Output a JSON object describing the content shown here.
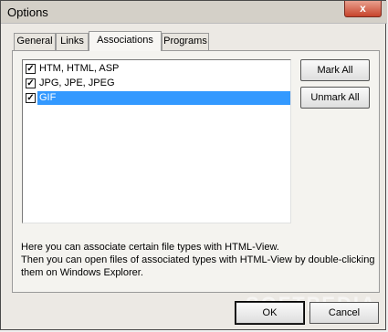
{
  "window": {
    "title": "Options",
    "close_glyph": "x"
  },
  "tabs": [
    {
      "label": "General",
      "active": false
    },
    {
      "label": "Links",
      "active": false
    },
    {
      "label": "Associations",
      "active": true
    },
    {
      "label": "Programs",
      "active": false
    }
  ],
  "associations": {
    "items": [
      {
        "label": "HTM, HTML, ASP",
        "checked": true,
        "selected": false
      },
      {
        "label": "JPG, JPE, JPEG",
        "checked": true,
        "selected": false
      },
      {
        "label": "GIF",
        "checked": true,
        "selected": true
      }
    ],
    "mark_all_label": "Mark All",
    "unmark_all_label": "Unmark All"
  },
  "description": {
    "line1": "Here you can associate certain file types with HTML-View.",
    "line2": "Then you can open files of associated types with HTML-View by double-clicking",
    "line3": "them on Windows Explorer."
  },
  "footer": {
    "ok_label": "OK",
    "cancel_label": "Cancel",
    "watermark": "SOFTPEDIA"
  },
  "colors": {
    "selection": "#3399ff",
    "close_button": "#c7442b"
  }
}
